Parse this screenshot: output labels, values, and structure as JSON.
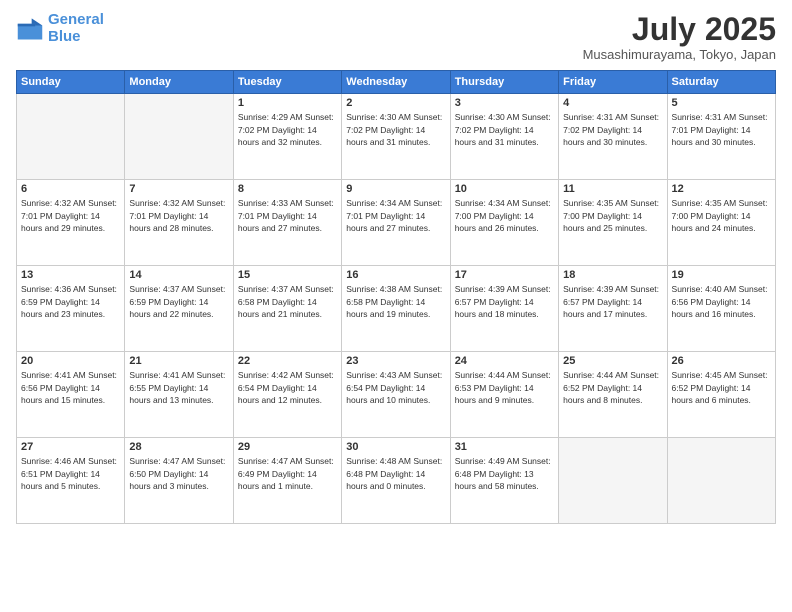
{
  "logo": {
    "line1": "General",
    "line2": "Blue"
  },
  "title": "July 2025",
  "subtitle": "Musashimurayama, Tokyo, Japan",
  "weekdays": [
    "Sunday",
    "Monday",
    "Tuesday",
    "Wednesday",
    "Thursday",
    "Friday",
    "Saturday"
  ],
  "weeks": [
    [
      {
        "day": "",
        "info": ""
      },
      {
        "day": "",
        "info": ""
      },
      {
        "day": "1",
        "info": "Sunrise: 4:29 AM\nSunset: 7:02 PM\nDaylight: 14 hours and 32 minutes."
      },
      {
        "day": "2",
        "info": "Sunrise: 4:30 AM\nSunset: 7:02 PM\nDaylight: 14 hours and 31 minutes."
      },
      {
        "day": "3",
        "info": "Sunrise: 4:30 AM\nSunset: 7:02 PM\nDaylight: 14 hours and 31 minutes."
      },
      {
        "day": "4",
        "info": "Sunrise: 4:31 AM\nSunset: 7:02 PM\nDaylight: 14 hours and 30 minutes."
      },
      {
        "day": "5",
        "info": "Sunrise: 4:31 AM\nSunset: 7:01 PM\nDaylight: 14 hours and 30 minutes."
      }
    ],
    [
      {
        "day": "6",
        "info": "Sunrise: 4:32 AM\nSunset: 7:01 PM\nDaylight: 14 hours and 29 minutes."
      },
      {
        "day": "7",
        "info": "Sunrise: 4:32 AM\nSunset: 7:01 PM\nDaylight: 14 hours and 28 minutes."
      },
      {
        "day": "8",
        "info": "Sunrise: 4:33 AM\nSunset: 7:01 PM\nDaylight: 14 hours and 27 minutes."
      },
      {
        "day": "9",
        "info": "Sunrise: 4:34 AM\nSunset: 7:01 PM\nDaylight: 14 hours and 27 minutes."
      },
      {
        "day": "10",
        "info": "Sunrise: 4:34 AM\nSunset: 7:00 PM\nDaylight: 14 hours and 26 minutes."
      },
      {
        "day": "11",
        "info": "Sunrise: 4:35 AM\nSunset: 7:00 PM\nDaylight: 14 hours and 25 minutes."
      },
      {
        "day": "12",
        "info": "Sunrise: 4:35 AM\nSunset: 7:00 PM\nDaylight: 14 hours and 24 minutes."
      }
    ],
    [
      {
        "day": "13",
        "info": "Sunrise: 4:36 AM\nSunset: 6:59 PM\nDaylight: 14 hours and 23 minutes."
      },
      {
        "day": "14",
        "info": "Sunrise: 4:37 AM\nSunset: 6:59 PM\nDaylight: 14 hours and 22 minutes."
      },
      {
        "day": "15",
        "info": "Sunrise: 4:37 AM\nSunset: 6:58 PM\nDaylight: 14 hours and 21 minutes."
      },
      {
        "day": "16",
        "info": "Sunrise: 4:38 AM\nSunset: 6:58 PM\nDaylight: 14 hours and 19 minutes."
      },
      {
        "day": "17",
        "info": "Sunrise: 4:39 AM\nSunset: 6:57 PM\nDaylight: 14 hours and 18 minutes."
      },
      {
        "day": "18",
        "info": "Sunrise: 4:39 AM\nSunset: 6:57 PM\nDaylight: 14 hours and 17 minutes."
      },
      {
        "day": "19",
        "info": "Sunrise: 4:40 AM\nSunset: 6:56 PM\nDaylight: 14 hours and 16 minutes."
      }
    ],
    [
      {
        "day": "20",
        "info": "Sunrise: 4:41 AM\nSunset: 6:56 PM\nDaylight: 14 hours and 15 minutes."
      },
      {
        "day": "21",
        "info": "Sunrise: 4:41 AM\nSunset: 6:55 PM\nDaylight: 14 hours and 13 minutes."
      },
      {
        "day": "22",
        "info": "Sunrise: 4:42 AM\nSunset: 6:54 PM\nDaylight: 14 hours and 12 minutes."
      },
      {
        "day": "23",
        "info": "Sunrise: 4:43 AM\nSunset: 6:54 PM\nDaylight: 14 hours and 10 minutes."
      },
      {
        "day": "24",
        "info": "Sunrise: 4:44 AM\nSunset: 6:53 PM\nDaylight: 14 hours and 9 minutes."
      },
      {
        "day": "25",
        "info": "Sunrise: 4:44 AM\nSunset: 6:52 PM\nDaylight: 14 hours and 8 minutes."
      },
      {
        "day": "26",
        "info": "Sunrise: 4:45 AM\nSunset: 6:52 PM\nDaylight: 14 hours and 6 minutes."
      }
    ],
    [
      {
        "day": "27",
        "info": "Sunrise: 4:46 AM\nSunset: 6:51 PM\nDaylight: 14 hours and 5 minutes."
      },
      {
        "day": "28",
        "info": "Sunrise: 4:47 AM\nSunset: 6:50 PM\nDaylight: 14 hours and 3 minutes."
      },
      {
        "day": "29",
        "info": "Sunrise: 4:47 AM\nSunset: 6:49 PM\nDaylight: 14 hours and 1 minute."
      },
      {
        "day": "30",
        "info": "Sunrise: 4:48 AM\nSunset: 6:48 PM\nDaylight: 14 hours and 0 minutes."
      },
      {
        "day": "31",
        "info": "Sunrise: 4:49 AM\nSunset: 6:48 PM\nDaylight: 13 hours and 58 minutes."
      },
      {
        "day": "",
        "info": ""
      },
      {
        "day": "",
        "info": ""
      }
    ]
  ]
}
